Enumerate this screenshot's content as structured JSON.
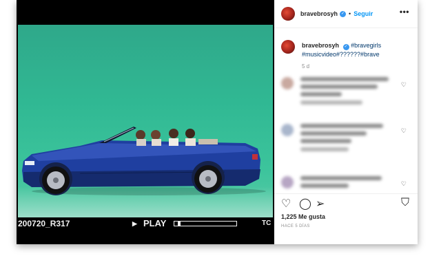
{
  "post": {
    "username": "bravebrosyh",
    "follow_label": "Seguir",
    "more_label": "•••",
    "verified_mark": "✓",
    "caption_tags_line1": "#bravegirls",
    "caption_tags_line2": "#musicvideo#??????#brave",
    "time_ago": "5 d",
    "likes_count": "1,225",
    "likes_label": "Me gusta",
    "posted_date": "HACE 5 DÍAS"
  },
  "video": {
    "clip_id": "200720_R317",
    "play_label": "PLAY",
    "play_icon": "▶",
    "timecode_label": "TC",
    "timeline_progress": 0.06
  },
  "actions": {
    "like_icon": "♡",
    "comment_icon": "◯",
    "share_icon": "➢",
    "save_icon": "⛉"
  },
  "comment_like_icon": "♡",
  "colors": {
    "accent": "#0095f6",
    "verified": "#3897f0",
    "chroma_green": "#30b893",
    "car_blue": "#1f3fa0"
  }
}
